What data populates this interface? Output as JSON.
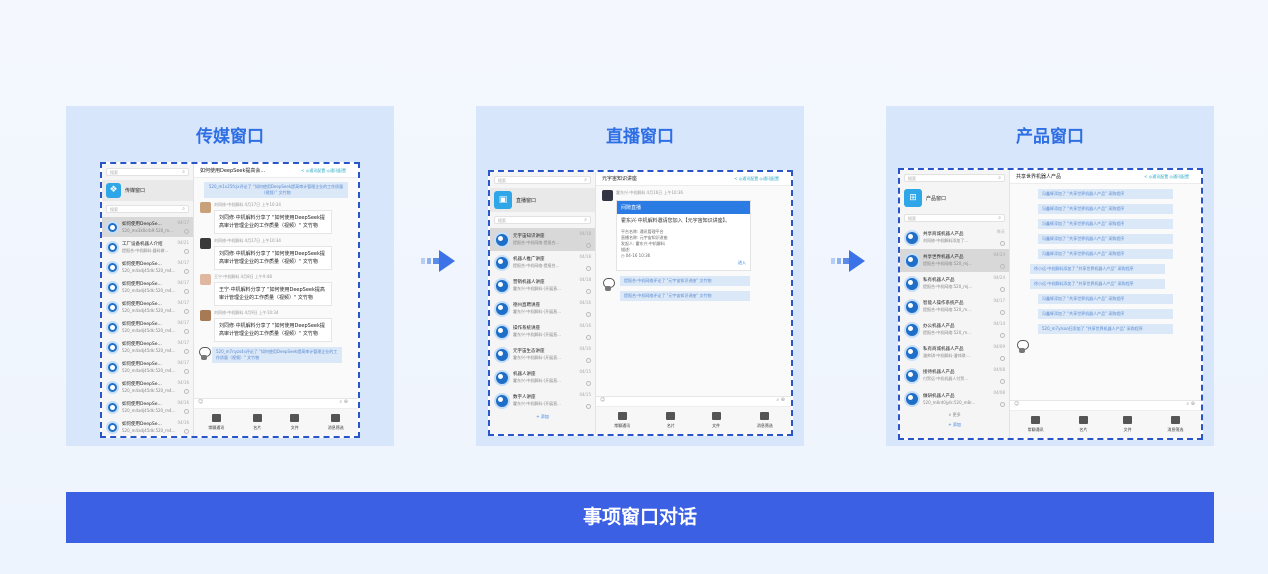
{
  "panels": [
    {
      "title": "传媒窗口",
      "window": {
        "search_placeholder": "搜索",
        "group_name": "传媒窗口",
        "list_search_placeholder": "搜索",
        "items": [
          {
            "title": "如何使用DeepSe...",
            "sub": "520_mx3k0crb9:520_m...",
            "date": "04/17",
            "selected": true
          },
          {
            "title": "工厂设备机器人介绍",
            "sub": "提报合·中机解料·器料做...",
            "date": "04/21",
            "selected": false
          },
          {
            "title": "如何使用DeepSe...",
            "sub": "520_m4adj45dk:520_m4...",
            "date": "04/17",
            "selected": false
          },
          {
            "title": "如何使用DeepSe...",
            "sub": "520_m4adj45dk:520_m4...",
            "date": "04/17",
            "selected": false
          },
          {
            "title": "如何使用DeepSe...",
            "sub": "520_m4adj45dk:520_m4...",
            "date": "04/17",
            "selected": false
          },
          {
            "title": "如何使用DeepSe...",
            "sub": "520_m4adj45dk:520_m4...",
            "date": "04/17",
            "selected": false
          },
          {
            "title": "如何使用DeepSe...",
            "sub": "520_m4adj45dk:520_m4...",
            "date": "04/17",
            "selected": false
          },
          {
            "title": "如何使用DeepSe...",
            "sub": "520_m4adj45dk:520_m4...",
            "date": "04/17",
            "selected": false
          },
          {
            "title": "如何使用DeepSe...",
            "sub": "520_m4adj45dk:520_m4...",
            "date": "04/16",
            "selected": false
          },
          {
            "title": "如何使用DeepSe...",
            "sub": "520_m4adj45dk:520_m4...",
            "date": "04/16",
            "selected": false
          },
          {
            "title": "如何使用DeepSe...",
            "sub": "520_m4adj45dk:520_m4...",
            "date": "04/16",
            "selected": false
          }
        ],
        "chat_title": "如何使用DeepSeek提高会...",
        "chat_actions": {
          "back": "<",
          "notify": "◎通讯配置",
          "options": "◎通讯配置"
        },
        "notice_top": "520_m1v25fcjx评论了 “如何使用DeepSeek提高审计管理企业的工作质量（视频）” 文竹物",
        "messages": [
          {
            "meta": "刘同修·中机解料 4月17日 上午10:34",
            "text": "刘同修·中机解料分享了 \"如何使用DeepSeek提高审计管理企业的工作质量（视频）\" 文竹物"
          },
          {
            "meta": "刘同修·中机解料 4月17日 上午10:34",
            "text": "刘同修·中机解料分享了 \"如何使用DeepSeek提高审计管理企业的工作质量（视频）\" 文竹物"
          },
          {
            "meta": "王宁·中机解料 4月8日 上午9:48",
            "text": "王宁·中机解料分享了 \"如何使用DeepSeek提高审计管理企业的工作质量（视频）\" 文竹物"
          },
          {
            "meta": "刘同修·中机解料 4月9日 上午10:34",
            "text": "刘同修·中机解料分享了 \"如何使用DeepSeek提高审计管理企业的工作质量（视频）\" 文竹物"
          }
        ],
        "notice_bottom": "520_m7nyzs4s评论了 \"如何使用DeepSeek提高审计管理企业的工作质量（视频）\" 文竹物",
        "tools": [
          "常聊通讯",
          "名片",
          "文件",
          "消息筛选"
        ]
      }
    },
    {
      "title": "直播窗口",
      "window": {
        "search_placeholder": "搜索",
        "group_name": "直播窗口",
        "list_search_placeholder": "搜索",
        "items": [
          {
            "title": "元宇宙知识讲座",
            "sub": "提报合·中机网络·提报合...",
            "date": "04/18",
            "selected": true
          },
          {
            "title": "机器人推广讲座",
            "sub": "提报合·中机网络·提报合...",
            "date": "04/18",
            "selected": false
          },
          {
            "title": "营销机器人讲座",
            "sub": "霍东兴·中机解料·(开展直...",
            "date": "04/18",
            "selected": false
          },
          {
            "title": "德州直聘讲座",
            "sub": "霍东兴·中机解料·(开展直...",
            "date": "04/16",
            "selected": false
          },
          {
            "title": "操作系统讲座",
            "sub": "霍东兴·中机解料·(开展直...",
            "date": "04/16",
            "selected": false
          },
          {
            "title": "元宇宙生态讲座",
            "sub": "霍东兴·中机解料·(开展直...",
            "date": "04/16",
            "selected": false
          },
          {
            "title": "机器人讲座",
            "sub": "霍东兴·中机解料·(开展直...",
            "date": "04/15",
            "selected": false
          },
          {
            "title": "数字人讲座",
            "sub": "霍东兴·中机解料·(开展直...",
            "date": "04/15",
            "selected": false
          }
        ],
        "add_label": "+ 添加",
        "chat_title": "元宇宙知识讲座",
        "chat_actions": {
          "back": "<",
          "notify": "◎通讯配置",
          "options": "◎通讯配置"
        },
        "sender_meta": "霍东兴·中机解料 4月16日 上午10:36",
        "card": {
          "header": "间隙直播",
          "text": "霍东兴·中机解料邀请您加入【元宇宙知识讲座】。",
          "rows": [
            "平台名称: 通讯管理平台",
            "直播名称: 元宇宙知识讲座",
            "发起人: 霍东兴·中机解料",
            "描述:"
          ],
          "time": "◷ 04-16 10:36",
          "enter": "进入"
        },
        "notices": [
          "提报合·中机网络评论了 \"元宇宙知识讲座\" 文竹物",
          "提报合·中机网络评论了 \"元宇宙知识讲座\" 文竹物"
        ],
        "tools": [
          "常聊通讯",
          "名片",
          "文件",
          "消息筛选"
        ]
      }
    },
    {
      "title": "产品窗口",
      "window": {
        "search_placeholder": "搜索",
        "group_name": "产品窗口",
        "list_search_placeholder": "搜索",
        "items": [
          {
            "title": "共享商城机器人产品",
            "sub": "刘同修·中机解料添加了...",
            "date": "昨天",
            "selected": false
          },
          {
            "title": "共享世界机器人产品",
            "sub": "提报合·中机网络:520_mj...",
            "date": "04/24",
            "selected": true
          },
          {
            "title": "私有机器人产品",
            "sub": "提报合·中机网络:520_mj...",
            "date": "04/24",
            "selected": false
          },
          {
            "title": "智能人操作系统产品",
            "sub": "提报合·中机网络:520_m...",
            "date": "04/17",
            "selected": false
          },
          {
            "title": "办公机器人产品",
            "sub": "提报合·中机网络:520_m...",
            "date": "04/14",
            "selected": false
          },
          {
            "title": "私有商城机器人产品",
            "sub": "潘帅琪·中机解料·潘帅琪·...",
            "date": "04/09",
            "selected": false
          },
          {
            "title": "接待机器人产品",
            "sub": "付贺远·中机机器人付贺...",
            "date": "04/08",
            "selected": false
          },
          {
            "title": "做研机器人产品",
            "sub": "520_m8rd0jylk:520_m8r...",
            "date": "04/08",
            "selected": false
          }
        ],
        "more_label": "∨ 更多",
        "add_label": "+ 添加",
        "chat_title": "共享世界机器人产品",
        "chat_actions": {
          "back": "<",
          "notify": "◎通讯配置",
          "options": "◎通讯配置"
        },
        "notices": [
          "冯鑫辉添加了 \"共享世界机器人产品\" 采购程序",
          "冯鑫辉添加了 \"共享世界机器人产品\" 采购程序",
          "冯鑫辉添加了 \"共享世界机器人产品\" 采购程序",
          "冯鑫辉添加了 \"共享世界机器人产品\" 采购程序",
          "冯鑫辉添加了 \"共享世界机器人产品\" 采购程序",
          "徐小远·中机解料添加了 \"共享世界机器人产品\" 采购程序",
          "徐小远·中机解料添加了 \"共享世界机器人产品\" 采购程序",
          "冯鑫辉添加了 \"共享世界机器人产品\" 采购程序",
          "冯鑫辉添加了 \"共享世界机器人产品\" 采购程序",
          "520_m7ylsoo扫添加了 \"共享世界机器人产品\" 采购程序"
        ],
        "tools": [
          "常聊通讯",
          "名片",
          "文件",
          "消息筛选"
        ]
      }
    }
  ],
  "bottom_bar": {
    "label": "事项窗口对话"
  },
  "colors": {
    "accent": "#3b60e4",
    "title": "#2f6fe4",
    "panel_bg": "#d8e6fb",
    "dash": "#2a55c9"
  }
}
